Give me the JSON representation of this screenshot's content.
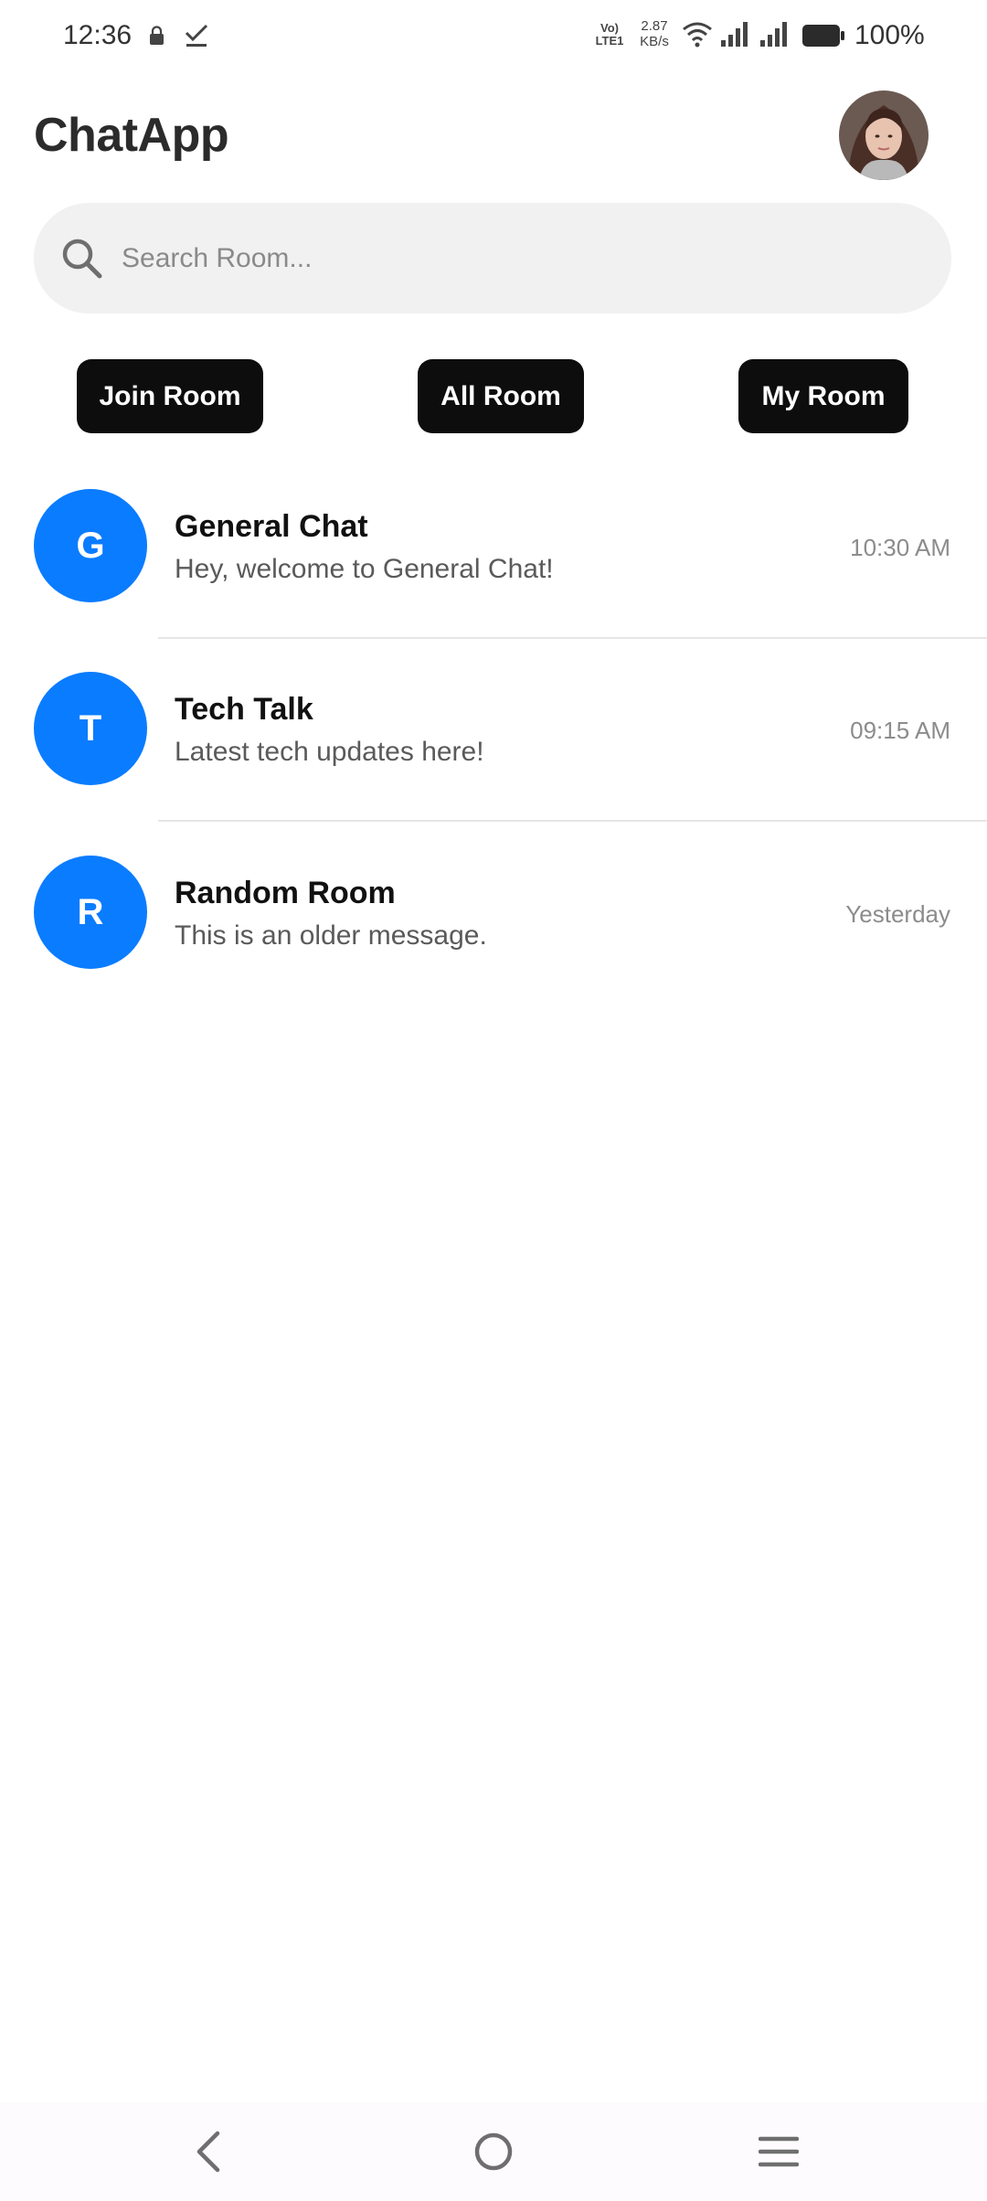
{
  "status_bar": {
    "time": "12:36",
    "volte_top": "Vo)",
    "volte_bottom": "LTE1",
    "speed_value": "2.87",
    "speed_unit": "KB/s",
    "battery": "100%"
  },
  "header": {
    "title": "ChatApp"
  },
  "search": {
    "placeholder": "Search Room..."
  },
  "actions": {
    "join_label": "Join Room",
    "all_label": "All Room",
    "my_label": "My Room"
  },
  "rooms": [
    {
      "initial": "G",
      "name": "General Chat",
      "message": "Hey, welcome to General Chat!",
      "time": "10:30 AM"
    },
    {
      "initial": "T",
      "name": "Tech Talk",
      "message": "Latest tech updates here!",
      "time": "09:15 AM"
    },
    {
      "initial": "R",
      "name": "Random Room",
      "message": "This is an older message.",
      "time": "Yesterday"
    }
  ],
  "colors": {
    "avatar_blue": "#0a7cff",
    "button_black": "#0d0d0d",
    "search_bg": "#f1f1f1"
  },
  "icons": [
    "lock-icon",
    "check-icon",
    "wifi-icon",
    "signal-icon",
    "battery-icon",
    "search-icon",
    "back-icon",
    "home-icon",
    "menu-icon"
  ]
}
